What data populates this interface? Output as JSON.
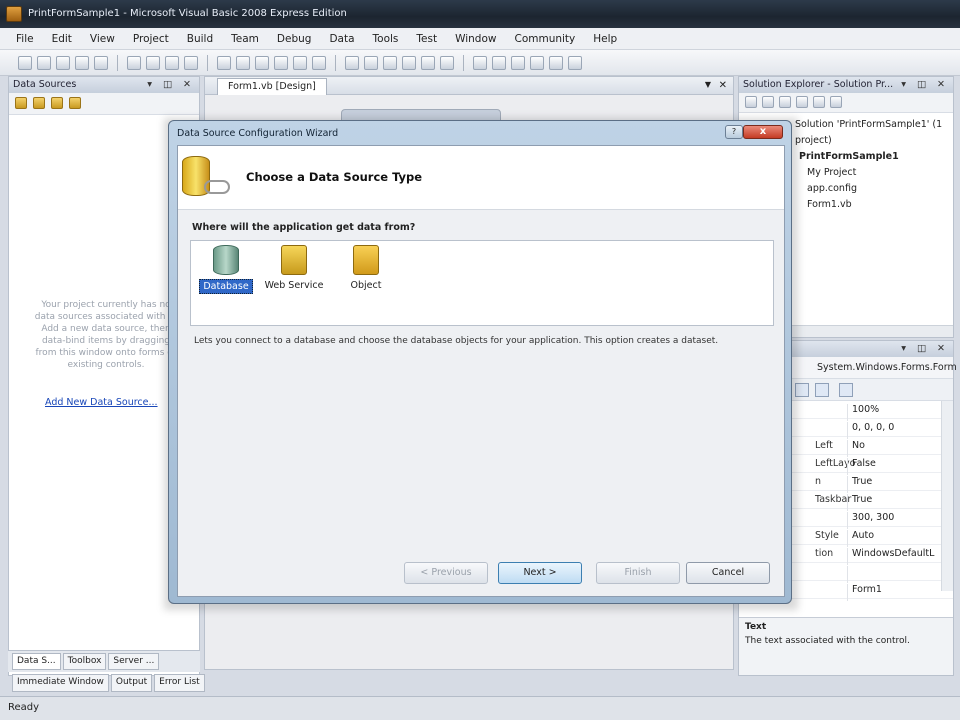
{
  "window": {
    "title": "PrintFormSample1 - Microsoft Visual Basic 2008 Express Edition"
  },
  "menu": [
    "File",
    "Edit",
    "View",
    "Project",
    "Build",
    "Team",
    "Debug",
    "Data",
    "Tools",
    "Test",
    "Window",
    "Community",
    "Help"
  ],
  "left_panel": {
    "title": "Data Sources",
    "empty_message": "Your project currently has no data sources associated with it. Add a new data source, then data-bind items by dragging from this window onto forms or existing controls.",
    "add_link": "Add New Data Source...",
    "tabs": [
      "Data S...",
      "Toolbox",
      "Server ..."
    ]
  },
  "bottom_tabs": [
    "Immediate Window",
    "Output",
    "Error List"
  ],
  "status": "Ready",
  "document": {
    "tab": "Form1.vb [Design]"
  },
  "solution_explorer": {
    "title": "Solution Explorer - Solution Pr...",
    "root": "Solution 'PrintFormSample1' (1 project)",
    "project": "PrintFormSample1",
    "items": [
      "My Project",
      "app.config",
      "Form1.vb"
    ]
  },
  "properties": {
    "object": "System.Windows.Forms.Form",
    "rows": [
      {
        "name": "",
        "value": "100%"
      },
      {
        "name": "",
        "value": "0, 0, 0, 0"
      },
      {
        "name": "Left",
        "value": "No"
      },
      {
        "name": "LeftLayo",
        "value": "False"
      },
      {
        "name": "n",
        "value": "True"
      },
      {
        "name": "Taskbar",
        "value": "True"
      },
      {
        "name": "",
        "value": "300, 300"
      },
      {
        "name": "Style",
        "value": "Auto"
      },
      {
        "name": "tion",
        "value": "WindowsDefaultL"
      },
      {
        "name": "",
        "value": ""
      },
      {
        "name": "",
        "value": "Form1"
      }
    ],
    "desc_title": "Text",
    "desc_text": "The text associated with the control."
  },
  "dialog": {
    "title": "Data Source Configuration Wizard",
    "heading": "Choose a Data Source Type",
    "question": "Where will the application get data from?",
    "choices": [
      {
        "label": "Database",
        "icon": "database-icon",
        "selected": true
      },
      {
        "label": "Web Service",
        "icon": "web-service-icon",
        "selected": false
      },
      {
        "label": "Object",
        "icon": "object-icon",
        "selected": false
      }
    ],
    "description": "Lets you connect to a database and choose the database objects for your application. This option creates a dataset.",
    "buttons": {
      "previous": "< Previous",
      "next": "Next >",
      "finish": "Finish",
      "cancel": "Cancel"
    },
    "close_glyph": "x",
    "min_glyph": "?"
  }
}
